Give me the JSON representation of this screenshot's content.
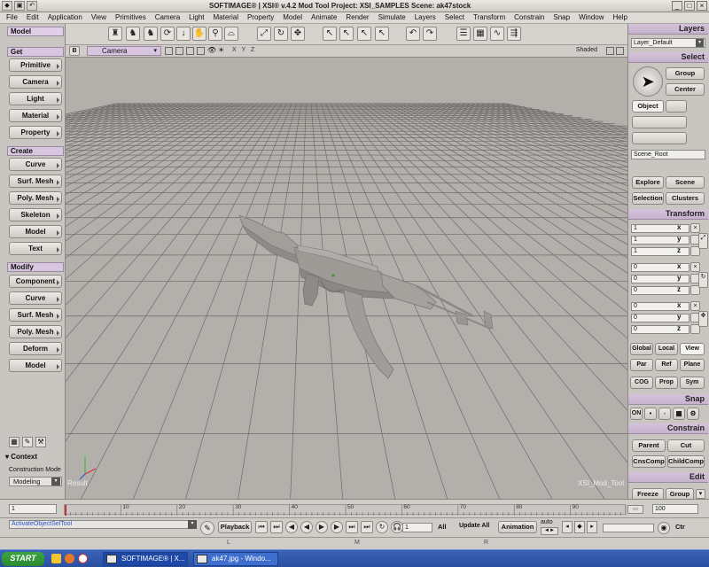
{
  "window": {
    "title": "SOFTIMAGE® | XSI® v.4.2 Mod Tool Project: XSI_SAMPLES     Scene: ak47stock"
  },
  "menu": [
    "File",
    "Edit",
    "Application",
    "View",
    "Primitives",
    "Camera",
    "Light",
    "Material",
    "Property",
    "Model",
    "Animate",
    "Render",
    "Simulate",
    "Layers",
    "Select",
    "Transform",
    "Constrain",
    "Snap",
    "Window",
    "Help"
  ],
  "left": {
    "mode": "Model",
    "get_header": "Get",
    "get_items": [
      "Primitive",
      "Camera",
      "Light",
      "Material",
      "Property"
    ],
    "create_header": "Create",
    "create_items": [
      "Curve",
      "Surf. Mesh",
      "Poly. Mesh",
      "Skeleton",
      "Model",
      "Text"
    ],
    "modify_header": "Modify",
    "modify_items": [
      "Component",
      "Curve",
      "Surf. Mesh",
      "Poly. Mesh",
      "Deform",
      "Model"
    ],
    "context_label": "Context",
    "construction_mode_label": "Construction Mode",
    "construction_mode_value": "Modeling"
  },
  "viewport": {
    "view_letter": "B",
    "camera": "Camera",
    "axes": "X Y Z",
    "shading": "Shaded",
    "result_label": "Result",
    "watermark": "XSI_Mod_Tool"
  },
  "right": {
    "layers_header": "Layers",
    "layer_value": "Layer_Default",
    "select_header": "Select",
    "group_btn": "Group",
    "center_btn": "Center",
    "object_btn": "Object",
    "scene_root": "Scene_Root",
    "explore_btn": "Explore",
    "scene_btn": "Scene",
    "selection_btn": "Selection",
    "clusters_btn": "Clusters",
    "transform_header": "Transform",
    "scale_values": [
      "1",
      "1",
      "1"
    ],
    "rotate_values": [
      "0",
      "0",
      "0"
    ],
    "translate_values": [
      "0",
      "0",
      "0"
    ],
    "axis_labels": [
      "x",
      "y",
      "z"
    ],
    "global_btn": "Global",
    "local_btn": "Local",
    "view_btn": "View",
    "par_btn": "Par",
    "ref_btn": "Ref",
    "plane_btn": "Plane",
    "cog_btn": "COG",
    "prop_btn": "Prop",
    "sym_btn": "Sym",
    "snap_header": "Snap",
    "snap_on": "ON",
    "constrain_header": "Constrain",
    "parent_btn": "Parent",
    "cut_btn": "Cut",
    "cnscomp_btn": "CnsComp",
    "childcomp_btn": "ChildComp",
    "edit_header": "Edit",
    "freeze_btn": "Freeze",
    "group2_btn": "Group"
  },
  "timeline": {
    "start_frame": "1",
    "end_frame": "100",
    "ticks": [
      "10",
      "20",
      "30",
      "40",
      "50",
      "60",
      "70",
      "80",
      "90"
    ]
  },
  "playback": {
    "status_cmd": "ActivateObjectSelTool",
    "playback_label": "Playback",
    "current_frame": "1",
    "all_btn": "All",
    "update_all_btn": "Update All",
    "animation_btn": "Animation",
    "auto_label": "auto",
    "ctr_label": "Ctr"
  },
  "status": {
    "l": "L",
    "m": "M",
    "r": "R"
  },
  "taskbar": {
    "start": "START",
    "items": [
      "SOFTIMAGE® | X...",
      "ak47.jpg - Windo..."
    ]
  },
  "colors": {
    "viewport_bg": "#b3afab",
    "panel_bg": "#c9c5c0",
    "header_accent": "#d4c3da"
  }
}
